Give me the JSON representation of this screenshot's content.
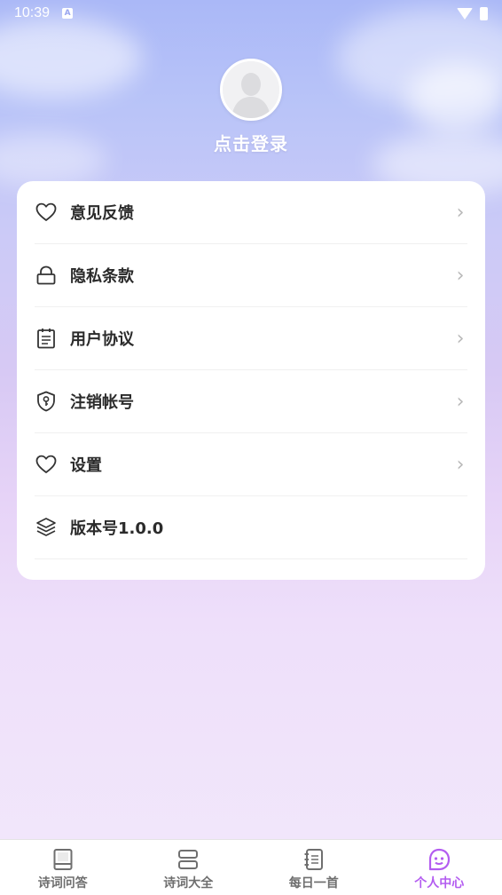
{
  "status_bar": {
    "time": "10:39",
    "notification_badge": "A"
  },
  "profile": {
    "login_label": "点击登录"
  },
  "menu": {
    "items": [
      {
        "label": "意见反馈",
        "icon": "heart-icon",
        "has_chevron": true
      },
      {
        "label": "隐私条款",
        "icon": "lock-icon",
        "has_chevron": true
      },
      {
        "label": "用户协议",
        "icon": "clipboard-icon",
        "has_chevron": true
      },
      {
        "label": "注销帐号",
        "icon": "shield-key-icon",
        "has_chevron": true
      },
      {
        "label": "设置",
        "icon": "heart-icon",
        "has_chevron": true
      },
      {
        "label": "版本号1.0.0",
        "icon": "layers-icon",
        "has_chevron": false
      }
    ],
    "chevron": "›"
  },
  "tabbar": {
    "tabs": [
      {
        "label": "诗词问答",
        "icon": "book-icon",
        "active": false
      },
      {
        "label": "诗词大全",
        "icon": "stack-icon",
        "active": false
      },
      {
        "label": "每日一首",
        "icon": "notebook-icon",
        "active": false
      },
      {
        "label": "个人中心",
        "icon": "smiley-icon",
        "active": true
      }
    ]
  },
  "colors": {
    "accent": "#b35cf0",
    "inactive_tab": "#6f6f6f",
    "text": "#2b2b2b"
  }
}
